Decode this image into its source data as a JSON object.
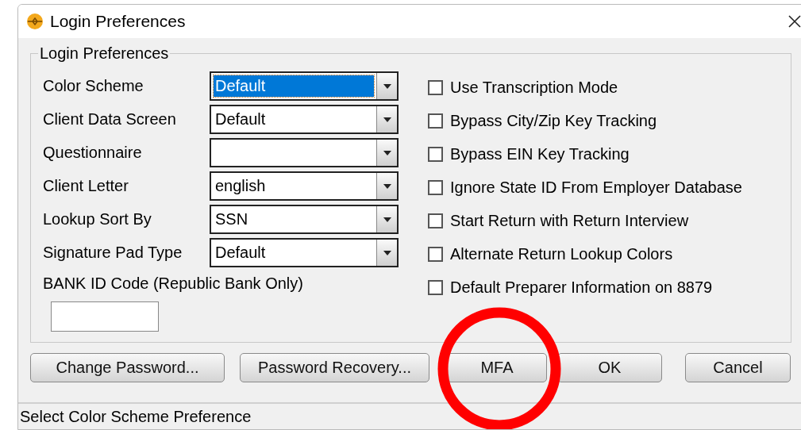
{
  "window": {
    "title": "Login Preferences"
  },
  "group": {
    "title": "Login Preferences"
  },
  "dropdowns": [
    {
      "label": "Color Scheme",
      "value": "Default",
      "selected": true
    },
    {
      "label": "Client Data Screen",
      "value": "Default",
      "selected": false
    },
    {
      "label": "Questionnaire",
      "selected": false
    },
    {
      "label": "Client Letter",
      "value": "english",
      "selected": false
    },
    {
      "label": "Lookup Sort By",
      "value": "SSN",
      "selected": false
    },
    {
      "label": "Signature Pad Type",
      "value": "Default",
      "selected": false
    }
  ],
  "bank_id": {
    "label": "BANK ID Code (Republic Bank Only)"
  },
  "checkboxes": [
    {
      "label": "Use Transcription Mode",
      "checked": false
    },
    {
      "label": "Bypass City/Zip Key Tracking",
      "checked": false
    },
    {
      "label": "Bypass EIN Key Tracking",
      "checked": false
    },
    {
      "label": "Ignore State ID From Employer Database",
      "checked": false
    },
    {
      "label": "Start Return with Return Interview",
      "checked": false
    },
    {
      "label": "Alternate Return Lookup Colors",
      "checked": false
    },
    {
      "label": "Default Preparer Information on 8879",
      "checked": false
    }
  ],
  "buttons": [
    {
      "label": "Change Password..."
    },
    {
      "label": "Password Recovery..."
    },
    {
      "label": "MFA",
      "highlighted": true
    },
    {
      "label": "OK"
    },
    {
      "label": "Cancel"
    }
  ],
  "status_bar": {
    "text": "Select Color Scheme Preference"
  }
}
